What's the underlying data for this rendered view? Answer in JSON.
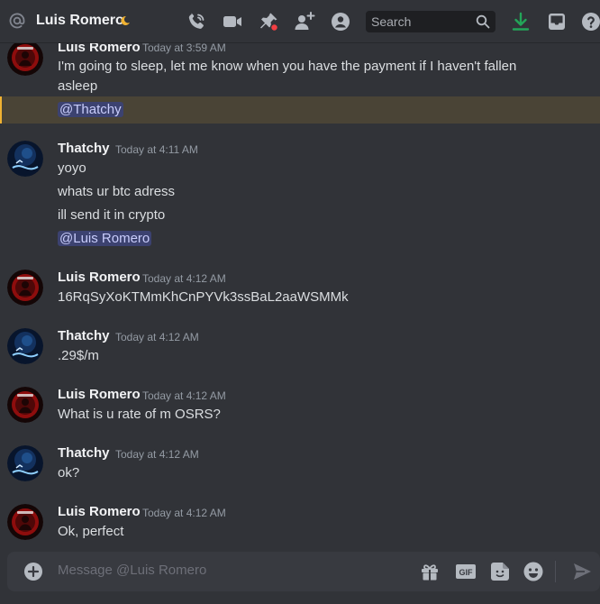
{
  "header": {
    "title": "Luis Romero",
    "search_placeholder": "Search"
  },
  "messages": [
    {
      "author": "Luis Romero",
      "timestamp": "Today at 3:59 AM",
      "avatar": "luis-avatar",
      "lines": [
        "I'm going to sleep, let me know when you have the payment if I haven't fallen",
        "asleep"
      ],
      "mention": "@Thatchy"
    },
    {
      "author": "Thatchy",
      "timestamp": "Today at 4:11 AM",
      "avatar": "thatchy-avatar",
      "lines": [
        "yoyo",
        "whats ur btc adress",
        "ill send it in crypto"
      ],
      "mention": "@Luis Romero"
    },
    {
      "author": "Luis Romero",
      "timestamp": "Today at 4:12 AM",
      "avatar": "luis-avatar",
      "lines": [
        "16RqSyXoKTMmKhCnPYVk3ssBaL2aaWSMMk"
      ]
    },
    {
      "author": "Thatchy",
      "timestamp": "Today at 4:12 AM",
      "avatar": "thatchy-avatar",
      "lines": [
        ".29$/m"
      ]
    },
    {
      "author": "Luis Romero",
      "timestamp": "Today at 4:12 AM",
      "avatar": "luis-avatar",
      "lines": [
        "What is u rate of m OSRS?"
      ]
    },
    {
      "author": "Thatchy",
      "timestamp": "Today at 4:12 AM",
      "avatar": "thatchy-avatar",
      "lines": [
        "ok?"
      ]
    },
    {
      "author": "Luis Romero",
      "timestamp": "Today at 4:12 AM",
      "avatar": "luis-avatar",
      "lines": [
        "Ok, perfect"
      ]
    }
  ],
  "composer": {
    "placeholder": "Message @Luis Romero",
    "gif_label": "GIF"
  },
  "colors": {
    "background": "#313338",
    "mention_bg": "#3c4270",
    "highlight_bg": "#4a4436",
    "download_green": "#23a559"
  }
}
